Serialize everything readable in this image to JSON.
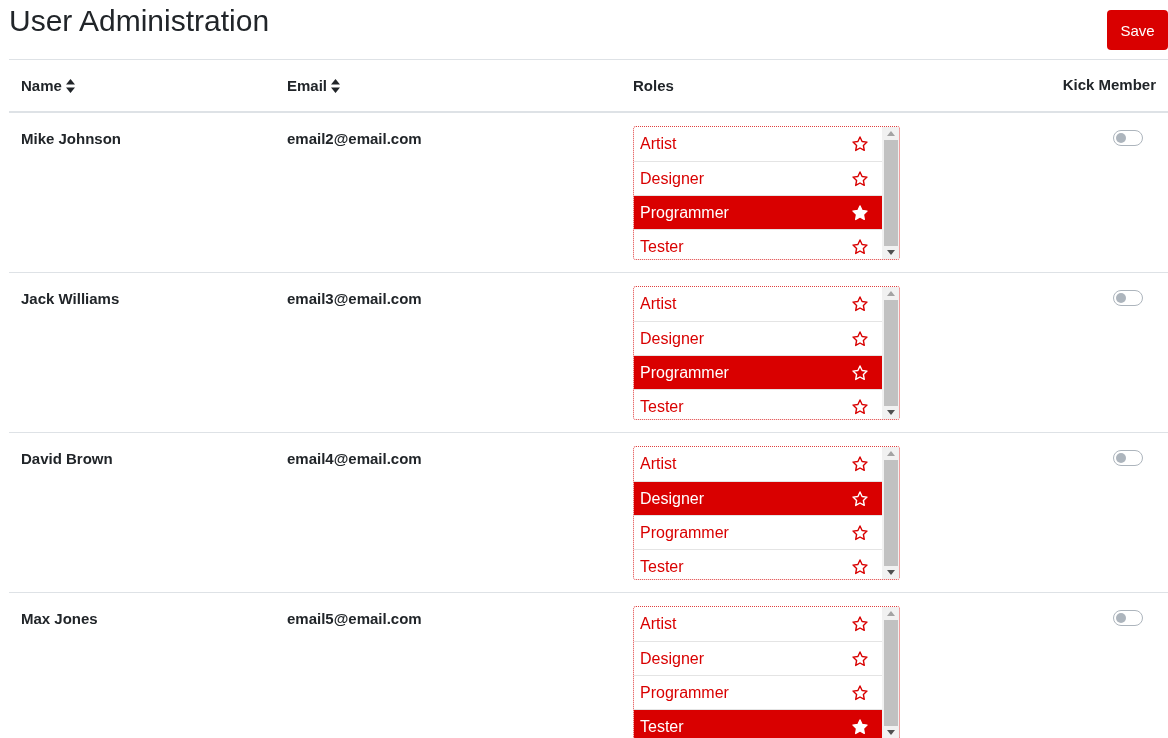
{
  "title": "User Administration",
  "save_button": "Save",
  "columns": [
    {
      "label": "Name",
      "sortable": true
    },
    {
      "label": "Email",
      "sortable": true
    },
    {
      "label": "Roles",
      "sortable": false
    },
    {
      "label": "Kick Member",
      "sortable": false
    }
  ],
  "rows": [
    {
      "name": "Mike Johnson",
      "email": "email2@email.com",
      "kick": false,
      "roles": [
        {
          "label": "Artist",
          "selected": false,
          "starred": false
        },
        {
          "label": "Designer",
          "selected": false,
          "starred": false
        },
        {
          "label": "Programmer",
          "selected": true,
          "starred": true
        },
        {
          "label": "Tester",
          "selected": false,
          "starred": false
        }
      ]
    },
    {
      "name": "Jack Williams",
      "email": "email3@email.com",
      "kick": false,
      "roles": [
        {
          "label": "Artist",
          "selected": false,
          "starred": false
        },
        {
          "label": "Designer",
          "selected": false,
          "starred": false
        },
        {
          "label": "Programmer",
          "selected": true,
          "starred": false
        },
        {
          "label": "Tester",
          "selected": false,
          "starred": false
        }
      ]
    },
    {
      "name": "David Brown",
      "email": "email4@email.com",
      "kick": false,
      "roles": [
        {
          "label": "Artist",
          "selected": false,
          "starred": false
        },
        {
          "label": "Designer",
          "selected": true,
          "starred": false
        },
        {
          "label": "Programmer",
          "selected": false,
          "starred": false
        },
        {
          "label": "Tester",
          "selected": false,
          "starred": false
        }
      ]
    },
    {
      "name": "Max Jones",
      "email": "email5@email.com",
      "kick": false,
      "roles": [
        {
          "label": "Artist",
          "selected": false,
          "starred": false
        },
        {
          "label": "Designer",
          "selected": false,
          "starred": false
        },
        {
          "label": "Programmer",
          "selected": false,
          "starred": false
        },
        {
          "label": "Tester",
          "selected": true,
          "starred": true
        }
      ]
    }
  ]
}
